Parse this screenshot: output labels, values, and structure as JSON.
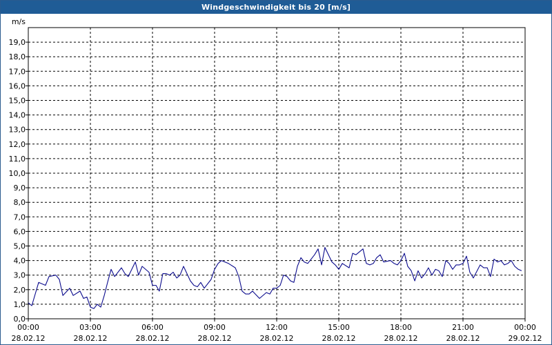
{
  "window": {
    "title": "Windgeschwindigkeit bis 20 [m/s]"
  },
  "chart_data": {
    "type": "line",
    "title": "Windgeschwindigkeit bis 20 [m/s]",
    "ylabel": "m/s",
    "xlabel": "",
    "ylim": [
      0,
      20
    ],
    "xlim": [
      0,
      24
    ],
    "grid": true,
    "y_ticks": [
      "0,0",
      "1,0",
      "2,0",
      "3,0",
      "4,0",
      "5,0",
      "6,0",
      "7,0",
      "8,0",
      "9,0",
      "10,0",
      "11,0",
      "12,0",
      "13,0",
      "14,0",
      "15,0",
      "16,0",
      "17,0",
      "18,0",
      "19,0"
    ],
    "x_ticks": [
      {
        "time": "00:00",
        "date": "28.02.12"
      },
      {
        "time": "03:00",
        "date": "28.02.12"
      },
      {
        "time": "06:00",
        "date": "28.02.12"
      },
      {
        "time": "09:00",
        "date": "28.02.12"
      },
      {
        "time": "12:00",
        "date": "28.02.12"
      },
      {
        "time": "15:00",
        "date": "28.02.12"
      },
      {
        "time": "18:00",
        "date": "28.02.12"
      },
      {
        "time": "21:00",
        "date": "28.02.12"
      },
      {
        "time": "00:00",
        "date": "29.02.12"
      }
    ],
    "line_color": "#0a0a8c",
    "series": [
      {
        "values": [
          [
            0.0,
            1.1
          ],
          [
            0.17,
            0.9
          ],
          [
            0.5,
            2.5
          ],
          [
            0.83,
            2.3
          ],
          [
            1.0,
            2.9
          ],
          [
            1.33,
            3.0
          ],
          [
            1.5,
            2.7
          ],
          [
            1.67,
            1.6
          ],
          [
            2.0,
            2.1
          ],
          [
            2.17,
            1.6
          ],
          [
            2.5,
            1.9
          ],
          [
            2.67,
            1.4
          ],
          [
            2.83,
            1.5
          ],
          [
            3.0,
            0.8
          ],
          [
            3.17,
            0.7
          ],
          [
            3.33,
            1.0
          ],
          [
            3.5,
            0.8
          ],
          [
            3.67,
            1.6
          ],
          [
            3.83,
            2.5
          ],
          [
            4.0,
            3.4
          ],
          [
            4.17,
            2.9
          ],
          [
            4.5,
            3.5
          ],
          [
            4.67,
            3.1
          ],
          [
            4.83,
            2.9
          ],
          [
            5.17,
            3.9
          ],
          [
            5.33,
            3.0
          ],
          [
            5.5,
            3.6
          ],
          [
            5.83,
            3.2
          ],
          [
            6.0,
            2.3
          ],
          [
            6.17,
            2.3
          ],
          [
            6.33,
            1.9
          ],
          [
            6.5,
            3.1
          ],
          [
            6.67,
            3.1
          ],
          [
            6.83,
            3.0
          ],
          [
            7.0,
            3.2
          ],
          [
            7.17,
            2.8
          ],
          [
            7.33,
            3.0
          ],
          [
            7.5,
            3.6
          ],
          [
            7.83,
            2.6
          ],
          [
            8.0,
            2.3
          ],
          [
            8.17,
            2.2
          ],
          [
            8.33,
            2.5
          ],
          [
            8.5,
            2.1
          ],
          [
            8.83,
            2.7
          ],
          [
            9.0,
            3.4
          ],
          [
            9.17,
            3.8
          ],
          [
            9.33,
            4.0
          ],
          [
            9.67,
            3.8
          ],
          [
            10.0,
            3.5
          ],
          [
            10.17,
            2.9
          ],
          [
            10.33,
            1.9
          ],
          [
            10.5,
            1.7
          ],
          [
            10.67,
            1.7
          ],
          [
            10.83,
            1.9
          ],
          [
            11.17,
            1.4
          ],
          [
            11.5,
            1.8
          ],
          [
            11.67,
            1.7
          ],
          [
            11.83,
            2.1
          ],
          [
            12.0,
            2.1
          ],
          [
            12.17,
            2.3
          ],
          [
            12.33,
            3.0
          ],
          [
            12.5,
            2.9
          ],
          [
            12.67,
            2.6
          ],
          [
            12.83,
            2.5
          ],
          [
            13.0,
            3.6
          ],
          [
            13.17,
            4.2
          ],
          [
            13.33,
            3.9
          ],
          [
            13.5,
            3.8
          ],
          [
            13.83,
            4.4
          ],
          [
            14.0,
            4.8
          ],
          [
            14.17,
            3.7
          ],
          [
            14.33,
            4.9
          ],
          [
            14.67,
            3.9
          ],
          [
            14.83,
            3.7
          ],
          [
            15.0,
            3.4
          ],
          [
            15.17,
            3.8
          ],
          [
            15.5,
            3.5
          ],
          [
            15.67,
            4.5
          ],
          [
            15.83,
            4.4
          ],
          [
            16.0,
            4.6
          ],
          [
            16.17,
            4.8
          ],
          [
            16.33,
            3.8
          ],
          [
            16.5,
            3.7
          ],
          [
            16.67,
            3.8
          ],
          [
            16.83,
            4.2
          ],
          [
            17.0,
            4.4
          ],
          [
            17.17,
            3.9
          ],
          [
            17.5,
            4.0
          ],
          [
            17.67,
            3.8
          ],
          [
            17.83,
            3.7
          ],
          [
            18.0,
            4.0
          ],
          [
            18.17,
            4.5
          ],
          [
            18.33,
            3.6
          ],
          [
            18.5,
            3.3
          ],
          [
            18.67,
            2.6
          ],
          [
            18.83,
            3.3
          ],
          [
            19.0,
            2.8
          ],
          [
            19.17,
            3.1
          ],
          [
            19.33,
            3.5
          ],
          [
            19.5,
            3.0
          ],
          [
            19.67,
            3.4
          ],
          [
            19.83,
            3.3
          ],
          [
            20.0,
            2.9
          ],
          [
            20.17,
            4.0
          ],
          [
            20.33,
            3.8
          ],
          [
            20.5,
            3.4
          ],
          [
            20.67,
            3.7
          ],
          [
            20.83,
            3.7
          ],
          [
            21.0,
            3.8
          ],
          [
            21.17,
            4.3
          ],
          [
            21.33,
            3.2
          ],
          [
            21.5,
            2.8
          ],
          [
            21.83,
            3.7
          ],
          [
            22.0,
            3.5
          ],
          [
            22.17,
            3.5
          ],
          [
            22.33,
            2.9
          ],
          [
            22.5,
            4.1
          ],
          [
            22.67,
            3.9
          ],
          [
            22.83,
            4.0
          ],
          [
            23.0,
            3.7
          ],
          [
            23.17,
            3.8
          ],
          [
            23.33,
            4.0
          ],
          [
            23.5,
            3.6
          ],
          [
            23.67,
            3.4
          ],
          [
            23.83,
            3.3
          ]
        ]
      }
    ]
  }
}
